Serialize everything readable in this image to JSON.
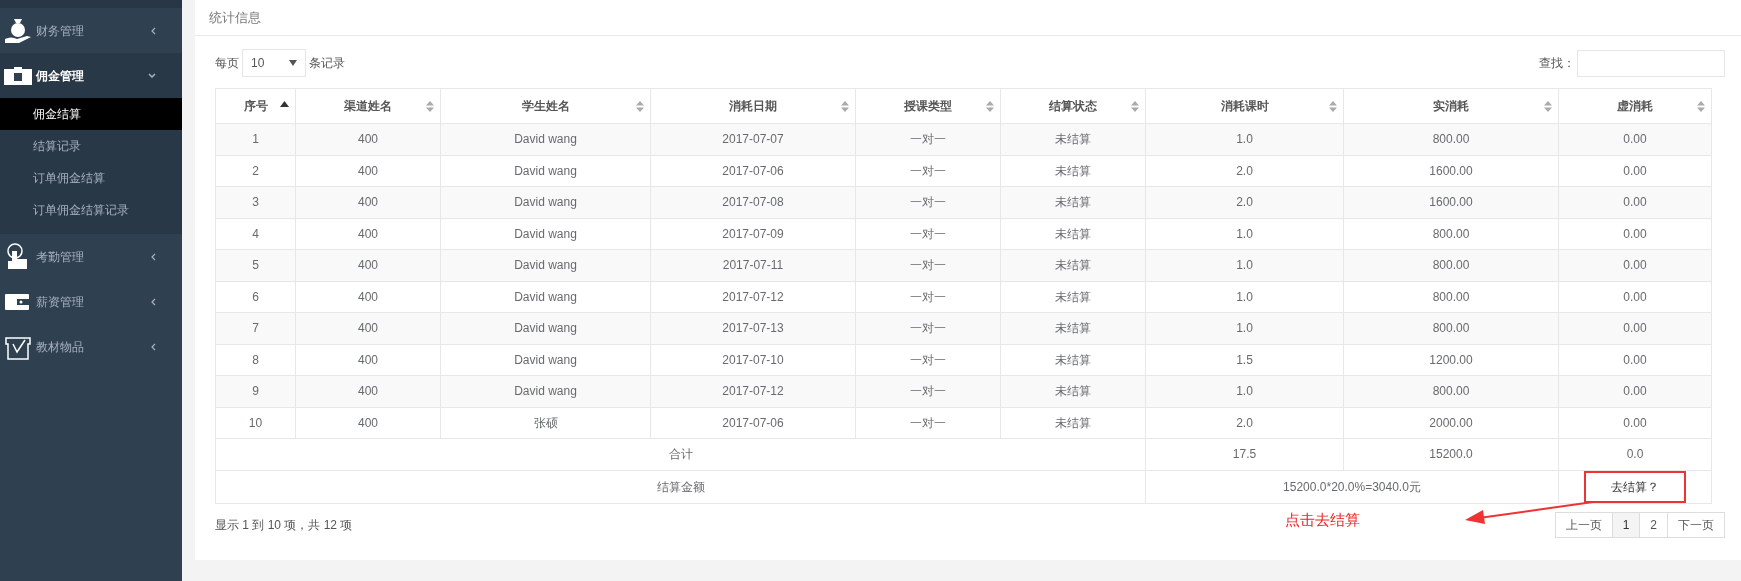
{
  "sidebar": {
    "items": [
      {
        "label": "财务管理",
        "expanded": false
      },
      {
        "label": "佣金管理",
        "expanded": true,
        "children": [
          {
            "label": "佣金结算",
            "selected": true
          },
          {
            "label": "结算记录",
            "selected": false
          },
          {
            "label": "订单佣金结算",
            "selected": false
          },
          {
            "label": "订单佣金结算记录",
            "selected": false
          }
        ]
      },
      {
        "label": "考勤管理",
        "expanded": false
      },
      {
        "label": "薪资管理",
        "expanded": false
      },
      {
        "label": "教材物品",
        "expanded": false
      }
    ]
  },
  "panel": {
    "title": "统计信息",
    "page_length": {
      "before": "每页",
      "value": "10",
      "after": "条记录"
    },
    "search": {
      "label": "查找："
    },
    "table": {
      "columns": [
        {
          "label": "序号",
          "sorted": true
        },
        {
          "label": "渠道姓名",
          "sorted": false
        },
        {
          "label": "学生姓名",
          "sorted": false
        },
        {
          "label": "消耗日期",
          "sorted": false
        },
        {
          "label": "授课类型",
          "sorted": false
        },
        {
          "label": "结算状态",
          "sorted": false
        },
        {
          "label": "消耗课时",
          "sorted": false
        },
        {
          "label": "实消耗",
          "sorted": false
        },
        {
          "label": "虚消耗",
          "sorted": false
        }
      ],
      "rows": [
        [
          "1",
          "400",
          "David wang",
          "2017-07-07",
          "一对一",
          "未结算",
          "1.0",
          "800.00",
          "0.00"
        ],
        [
          "2",
          "400",
          "David wang",
          "2017-07-06",
          "一对一",
          "未结算",
          "2.0",
          "1600.00",
          "0.00"
        ],
        [
          "3",
          "400",
          "David wang",
          "2017-07-08",
          "一对一",
          "未结算",
          "2.0",
          "1600.00",
          "0.00"
        ],
        [
          "4",
          "400",
          "David wang",
          "2017-07-09",
          "一对一",
          "未结算",
          "1.0",
          "800.00",
          "0.00"
        ],
        [
          "5",
          "400",
          "David wang",
          "2017-07-11",
          "一对一",
          "未结算",
          "1.0",
          "800.00",
          "0.00"
        ],
        [
          "6",
          "400",
          "David wang",
          "2017-07-12",
          "一对一",
          "未结算",
          "1.0",
          "800.00",
          "0.00"
        ],
        [
          "7",
          "400",
          "David wang",
          "2017-07-13",
          "一对一",
          "未结算",
          "1.0",
          "800.00",
          "0.00"
        ],
        [
          "8",
          "400",
          "David wang",
          "2017-07-10",
          "一对一",
          "未结算",
          "1.5",
          "1200.00",
          "0.00"
        ],
        [
          "9",
          "400",
          "David wang",
          "2017-07-12",
          "一对一",
          "未结算",
          "1.0",
          "800.00",
          "0.00"
        ],
        [
          "10",
          "400",
          "张硕",
          "2017-07-06",
          "一对一",
          "未结算",
          "2.0",
          "2000.00",
          "0.00"
        ]
      ],
      "total": {
        "label": "合计",
        "hours": "17.5",
        "actual": "15200.0",
        "virtual": "0.0"
      },
      "settlement": {
        "label": "结算金额",
        "formula": "15200.0*20.0%=3040.0元",
        "action": "去结算？"
      }
    },
    "info": "显示 1 到 10 项，共 12 项",
    "pagination": [
      {
        "label": "上一页",
        "selected": false
      },
      {
        "label": "1",
        "selected": true
      },
      {
        "label": "2",
        "selected": false
      },
      {
        "label": "下一页",
        "selected": false
      }
    ]
  },
  "annotation": {
    "text": "点击去结算"
  }
}
